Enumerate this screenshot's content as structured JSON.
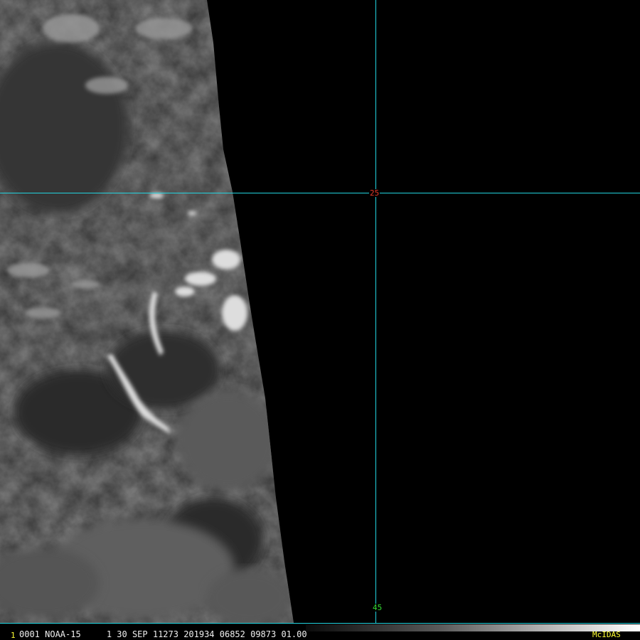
{
  "image": {
    "type": "satellite-imagery",
    "background_color": "#000000",
    "cloud_color": "#ffffff"
  },
  "grid": {
    "line_color": "#22d4e0",
    "latitude_label": "25",
    "latitude_label_color": "#e23a2a",
    "longitude_label": "45",
    "longitude_label_color": "#33dd33"
  },
  "status_bar": {
    "frame_number": "1",
    "text": "0001 NOAA-15     1 30 SEP 11273 201934 06852 09873 01.00",
    "brand": "McIDAS",
    "text_color": "#f0f0f0",
    "accent_color": "#ffff33"
  }
}
